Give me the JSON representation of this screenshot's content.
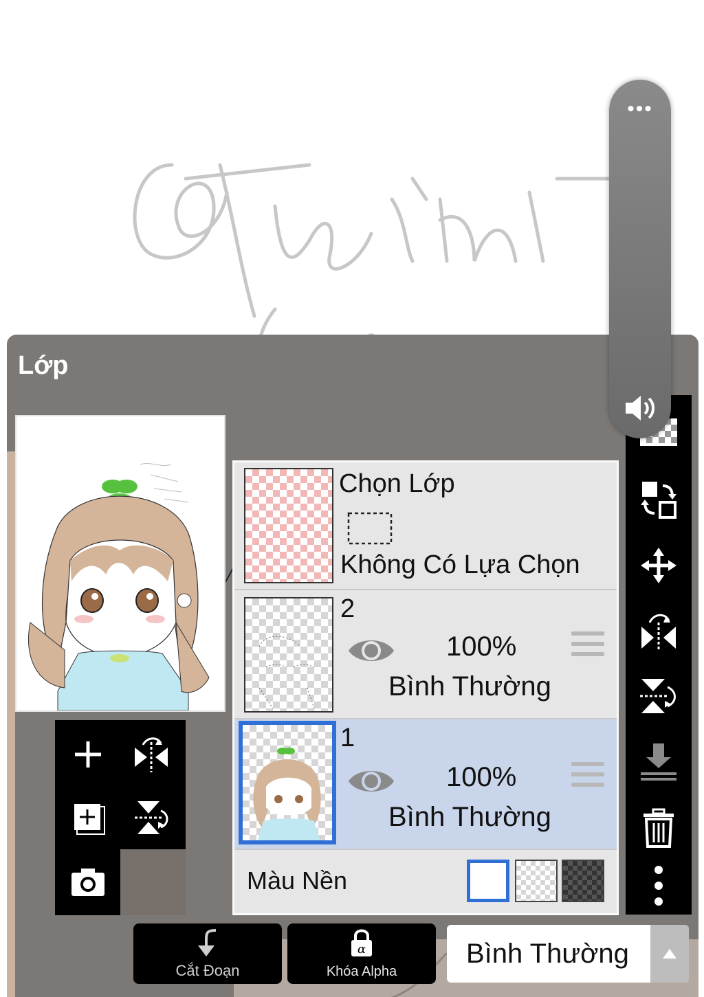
{
  "panel": {
    "title": "Lớp"
  },
  "layers": [
    {
      "type": "selection",
      "name": "Chọn Lớp",
      "status": "Không Có Lựa Chọn"
    },
    {
      "number": "2",
      "opacity": "100%",
      "blend_mode": "Bình Thường",
      "visible": true,
      "selected": false
    },
    {
      "number": "1",
      "opacity": "100%",
      "blend_mode": "Bình Thường",
      "visible": true,
      "selected": true
    }
  ],
  "background": {
    "label": "Màu Nền",
    "options": [
      "white",
      "transparent",
      "dark"
    ],
    "selected": "white"
  },
  "bottom_bar": {
    "clip_label": "Cắt Đoạn",
    "alpha_lock_label": "Khóa Alpha",
    "blend_mode_value": "Bình Thường"
  },
  "left_tools": [
    "add-layer-icon",
    "flip-horizontal-icon",
    "add-copy-icon",
    "flip-vertical-icon",
    "camera-icon"
  ],
  "right_toolbar": [
    "checker-icon",
    "swap-layer-icon",
    "move-icon",
    "flip-horizontal-icon",
    "flip-vertical-icon",
    "merge-down-icon",
    "trash-icon",
    "more-vertical-icon"
  ],
  "volume_overlay": {
    "menu_icon": "more-horizontal-icon",
    "speaker_icon": "speaker-icon",
    "level": 0.0
  },
  "colors": {
    "panel_bg": "#77706b",
    "selected_row": "#c9d5ea",
    "accent_blue": "#2f6fd6",
    "toolbar_bg": "#000000"
  }
}
